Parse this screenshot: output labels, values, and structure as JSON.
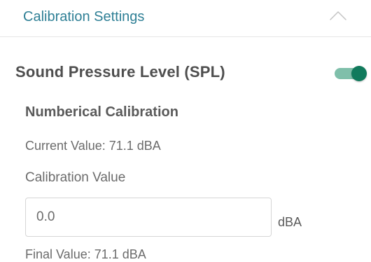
{
  "header": {
    "title": "Calibration Settings",
    "chevron_icon": "chevron-up-icon"
  },
  "spl": {
    "title": "Sound Pressure Level (SPL)",
    "toggle_on": true,
    "toggle_color": "#117a5c"
  },
  "numerical": {
    "title": "Numberical Calibration",
    "current_value": "Current Value: 71.1 dBA",
    "calibration_label": "Calibration Value",
    "calibration_input_value": "0.0",
    "unit": "dBA",
    "final_value": "Final Value: 71.1 dBA"
  },
  "colors": {
    "accent": "#2e7f95"
  }
}
